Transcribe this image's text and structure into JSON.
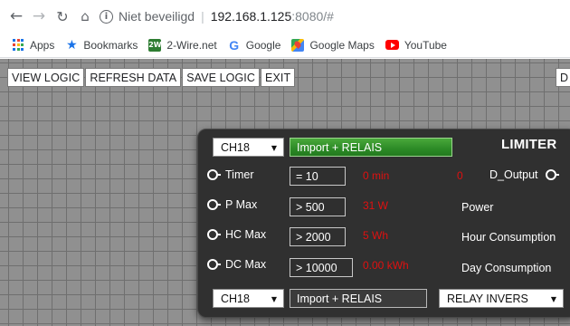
{
  "browser": {
    "security_label": "Niet beveiligd",
    "host": "192.168.1.125",
    "url_rest": ":8080/#",
    "bookmarks": [
      {
        "label": "Apps",
        "icon": "apps-grid-icon"
      },
      {
        "label": "Bookmarks",
        "icon": "star-icon"
      },
      {
        "label": "2-Wire.net",
        "icon": "wire-icon"
      },
      {
        "label": "Google",
        "icon": "google-icon"
      },
      {
        "label": "Google Maps",
        "icon": "maps-icon"
      },
      {
        "label": "YouTube",
        "icon": "youtube-icon"
      }
    ]
  },
  "menu": {
    "view_logic": "VIEW LOGIC",
    "refresh_data": "REFRESH DATA",
    "save_logic": "SAVE LOGIC",
    "exit": "EXIT",
    "right_button": "D"
  },
  "panel": {
    "title": "LIMITER",
    "top_channel": "CH18",
    "top_name": "Import + RELAIS",
    "bottom_channel": "CH18",
    "bottom_name": "Import + RELAIS",
    "relay_mode": "RELAY INVERS",
    "output_value": "0",
    "output_label": "D_Output",
    "rows": [
      {
        "label": "Timer",
        "setting": "= 10",
        "reading": "0 min",
        "right_label": ""
      },
      {
        "label": "P Max",
        "setting": "> 500",
        "reading": "31 W",
        "right_label": "Power"
      },
      {
        "label": "HC Max",
        "setting": "> 2000",
        "reading": "5 Wh",
        "right_label": "Hour Consumption"
      },
      {
        "label": "DC Max",
        "setting": "> 10000",
        "reading": "0.00 kWh",
        "right_label": "Day Consumption"
      }
    ]
  },
  "colors": {
    "panel_bg": "#303030",
    "reading_red": "#e01010",
    "name_green": "#2c8a26",
    "grid_bg": "#909090"
  }
}
